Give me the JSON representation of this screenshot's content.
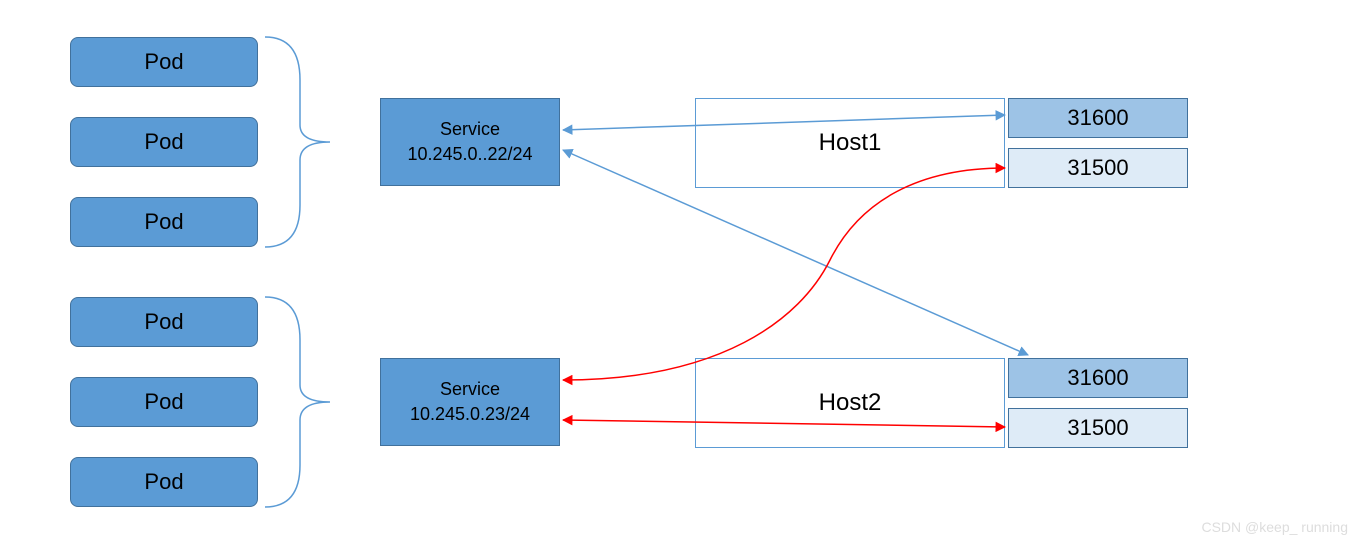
{
  "pods": {
    "group1": [
      "Pod",
      "Pod",
      "Pod"
    ],
    "group2": [
      "Pod",
      "Pod",
      "Pod"
    ]
  },
  "services": {
    "s1": {
      "title": "Service",
      "cidr": "10.245.0..22/24"
    },
    "s2": {
      "title": "Service",
      "cidr": "10.245.0.23/24"
    }
  },
  "hosts": {
    "h1": "Host1",
    "h2": "Host2"
  },
  "ports": {
    "p1": "31600",
    "p2": "31500",
    "p3": "31600",
    "p4": "31500"
  },
  "watermark": "CSDN @keep_ running"
}
